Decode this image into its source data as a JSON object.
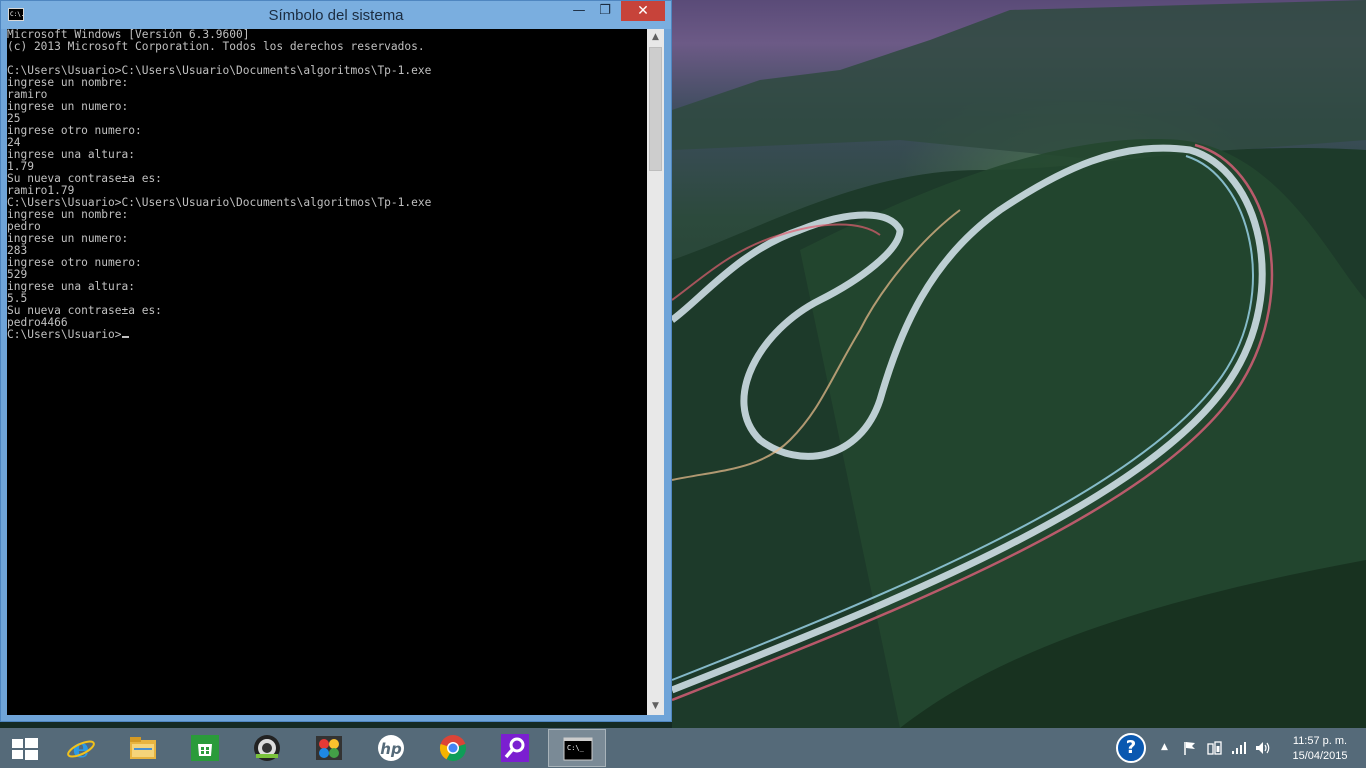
{
  "window": {
    "title": "Símbolo del sistema",
    "icon_label": "C:\\.",
    "minimize_glyph": "—",
    "maximize_glyph": "❐",
    "close_glyph": "✕"
  },
  "console": {
    "lines": [
      "Microsoft Windows [Versión 6.3.9600]",
      "(c) 2013 Microsoft Corporation. Todos los derechos reservados.",
      "",
      "C:\\Users\\Usuario>C:\\Users\\Usuario\\Documents\\algoritmos\\Tp-1.exe",
      "ingrese un nombre:",
      "ramiro",
      "ingrese un numero:",
      "25",
      "ingrese otro numero:",
      "24",
      "ingrese una altura:",
      "1.79",
      "Su nueva contrase±a es:",
      "ramiro1.79",
      "C:\\Users\\Usuario>C:\\Users\\Usuario\\Documents\\algoritmos\\Tp-1.exe",
      "ingrese un nombre:",
      "pedro",
      "ingrese un numero:",
      "283",
      "ingrese otro numero:",
      "529",
      "ingrese una altura:",
      "5.5",
      "Su nueva contrase±a es:",
      "pedro4466"
    ],
    "prompt": "C:\\Users\\Usuario>"
  },
  "taskbar": {
    "items": [
      {
        "name": "internet-explorer",
        "icon": "ie-icon"
      },
      {
        "name": "file-explorer",
        "icon": "folder-icon"
      },
      {
        "name": "store",
        "icon": "store-icon"
      },
      {
        "name": "camera-app",
        "icon": "camera-icon"
      },
      {
        "name": "paint-app",
        "icon": "paint-icon"
      },
      {
        "name": "hp-app",
        "icon": "hp-icon"
      },
      {
        "name": "chrome",
        "icon": "chrome-icon"
      },
      {
        "name": "search-app",
        "icon": "magnifier-icon"
      },
      {
        "name": "command-prompt",
        "icon": "cmd-icon",
        "active": true
      }
    ],
    "hp_label": "hp",
    "cmd_label": "C:\\_",
    "help_label": "?",
    "clock_time": "11:57 p. m.",
    "clock_date": "15/04/2015"
  },
  "colors": {
    "console_bg": "#000000",
    "console_fg": "#c0c0c0",
    "titlebar": "#7aaedf",
    "close_button": "#c7433a",
    "taskbar": "#556a79"
  }
}
